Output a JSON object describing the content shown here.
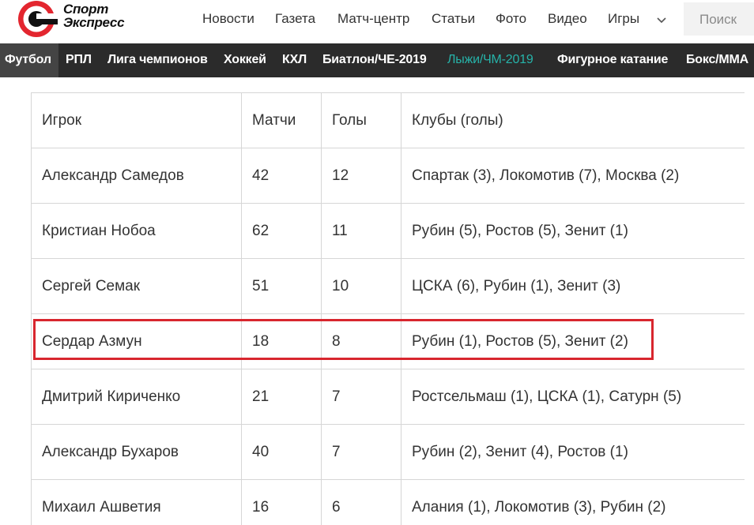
{
  "brand": {
    "line1": "Спорт",
    "line2": "Экспресс"
  },
  "top_nav": [
    {
      "label": "Новости"
    },
    {
      "label": "Газета"
    },
    {
      "label": "Матч-центр"
    },
    {
      "label": "Статьи"
    },
    {
      "label": "Фото"
    },
    {
      "label": "Видео"
    },
    {
      "label": "Игры"
    }
  ],
  "search": {
    "label": "Поиск"
  },
  "sub_nav": {
    "active": "Футбол",
    "highlight_color": "#26b3a9",
    "items": [
      {
        "label": "Футбол"
      },
      {
        "label": "РПЛ"
      },
      {
        "label": "Лига чемпионов"
      },
      {
        "label": "Хоккей"
      },
      {
        "label": "КХЛ"
      },
      {
        "label": "Биатлон/ЧЕ-2019"
      },
      {
        "label": "Лыжи/ЧМ-2019"
      },
      {
        "label": "Фигурное катание"
      },
      {
        "label": "Бокс/ММА"
      }
    ]
  },
  "table": {
    "headers": [
      "Игрок",
      "Матчи",
      "Голы",
      "Клубы (голы)"
    ],
    "rows": [
      [
        "Александр Самедов",
        "42",
        "12",
        "Спартак (3), Локомотив (7), Москва (2)"
      ],
      [
        "Кристиан Нобоа",
        "62",
        "11",
        "Рубин (5), Ростов (5), Зенит (1)"
      ],
      [
        "Сергей Семак",
        "51",
        "10",
        "ЦСКА (6), Рубин (1), Зенит (3)"
      ],
      [
        "Сердар Азмун",
        "18",
        "8",
        "Рубин (1), Ростов (5), Зенит (2)"
      ],
      [
        "Дмитрий Кириченко",
        "21",
        "7",
        "Ростсельмаш (1), ЦСКА (1), Сатурн (5)"
      ],
      [
        "Александр Бухаров",
        "40",
        "7",
        "Рубин (2), Зенит (4), Ростов (1)"
      ],
      [
        "Михаил Ашветия",
        "16",
        "6",
        "Алания (1), Локомотив (3), Рубин (2)"
      ]
    ],
    "highlight_color": "#d8262e"
  }
}
